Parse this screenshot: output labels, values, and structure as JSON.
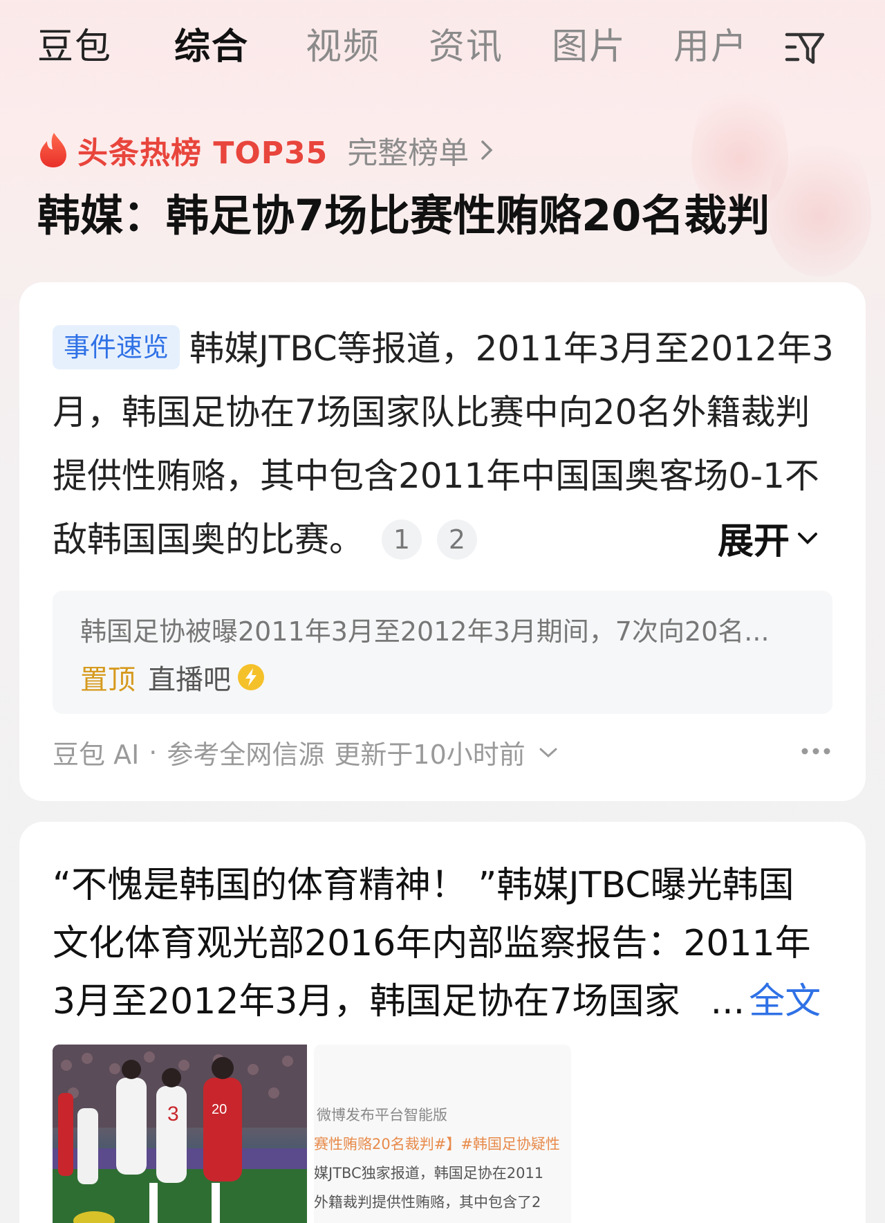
{
  "nav": {
    "brand": "豆包",
    "tabs": [
      "综合",
      "视频",
      "资讯",
      "图片",
      "用户"
    ],
    "active_tab": "综合"
  },
  "hot": {
    "label": "头条热榜 TOP35",
    "full_list": "完整榜单"
  },
  "headline": "韩媒：韩足协7场比赛性贿赂20名裁判",
  "summary_card": {
    "tag": "事件速览",
    "text": "韩媒JTBC等报道，2011年3月至2012年3月，韩国足协在7场国家队比赛中向20名外籍裁判提供性贿赂，其中包含2011年中国国奥客场0-1不敌韩国国奥的比赛。",
    "refs": [
      "1",
      "2"
    ],
    "expand": "展开",
    "quote": {
      "text": "韩国足协被曝2011年3月至2012年3月期间，7次向20名...",
      "pin": "置顶",
      "source": "直播吧"
    },
    "footer": {
      "ai": "豆包 AI",
      "dot": "·",
      "sources": "参考全网信源",
      "updated": "更新于10小时前"
    }
  },
  "post_card": {
    "lines": [
      "“不愧是韩国的体育精神！ ”韩媒JTBC曝光韩国",
      "文化体育观光部2016年内部监察报告：2011年",
      "3月至2012年3月，韩国足协在7场国家"
    ],
    "ellipsis": "...",
    "full_text": "全文",
    "thumb_2": {
      "line1": "微博发布平台智能版",
      "line2": "赛性贿赂20名裁判#】#韩国足协疑性",
      "line3": "媒JTBC独家报道，韩国足协在2011",
      "line4": "外籍裁判提供性贿赂，其中包含了2"
    }
  },
  "colors": {
    "hot_red": "#e8453c",
    "link_blue": "#2f71e6",
    "pin_gold": "#d69a1e"
  }
}
